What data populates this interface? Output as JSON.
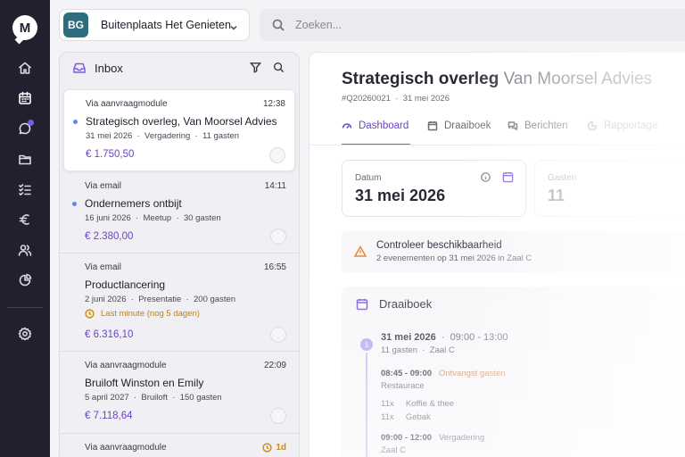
{
  "app": {
    "logo_letter": "M"
  },
  "venue": {
    "initials": "BG",
    "name": "Buitenplaats Het Genieten"
  },
  "search": {
    "placeholder": "Zoeken..."
  },
  "inbox": {
    "title": "Inbox",
    "items": [
      {
        "source": "Via aanvraagmodule",
        "time": "12:38",
        "title": "Strategisch overleg, Van Moorsel Advies",
        "date": "31 mei 2026",
        "type": "Vergadering",
        "guests": "11 gasten",
        "price": "€ 1.750,50",
        "unread": true
      },
      {
        "source": "Via email",
        "time": "14:11",
        "title": "Ondernemers ontbijt",
        "date": "16 juni 2026",
        "type": "Meetup",
        "guests": "30 gasten",
        "price": "€ 2.380,00",
        "unread": true
      },
      {
        "source": "Via email",
        "time": "16:55",
        "title": "Productlancering",
        "date": "2 juni 2026",
        "type": "Presentatie",
        "guests": "200 gasten",
        "warning": "Last minute (nog 5 dagen)",
        "price": "€ 6.316,10",
        "unread": false
      },
      {
        "source": "Via aanvraagmodule",
        "time": "22:09",
        "title": "Bruiloft Winston en Emily",
        "date": "5 april 2027",
        "type": "Bruiloft",
        "guests": "150 gasten",
        "price": "€ 7.118,64",
        "unread": false
      },
      {
        "source": "Via aanvraagmodule",
        "time": "1d",
        "unread": false
      }
    ]
  },
  "detail": {
    "title": "Strategisch overleg",
    "subtitle": "Van Moorsel Advies",
    "ref": "#Q20260021",
    "date": "31 mei 2026",
    "tabs": [
      "Dashboard",
      "Draaiboek",
      "Berichten",
      "Rapportage"
    ],
    "stats": [
      {
        "label": "Datum",
        "value": "31 mei 2026"
      },
      {
        "label": "Gasten",
        "value": "11"
      }
    ],
    "alert": {
      "title": "Controleer beschikbaarheid",
      "text": "2 evenementen op 31 mei 2026 in Zaal C"
    },
    "script": {
      "title": "Draaiboek",
      "step": "1",
      "date": "31 mei 2026",
      "time_range": "09:00 - 13:00",
      "guests": "11 gasten",
      "room": "Zaal C",
      "row1_time": "08:45 - 09:00",
      "row1_action": "Ontvangst gasten",
      "row1_place": "Restaurace",
      "item1_qty": "11x",
      "item1_name": "Koffie & thee",
      "item2_qty": "11x",
      "item2_name": "Gebak",
      "row2_time": "09:00 - 12:00",
      "row2_action": "Vergadering",
      "row2_place": "Zaal C"
    }
  }
}
